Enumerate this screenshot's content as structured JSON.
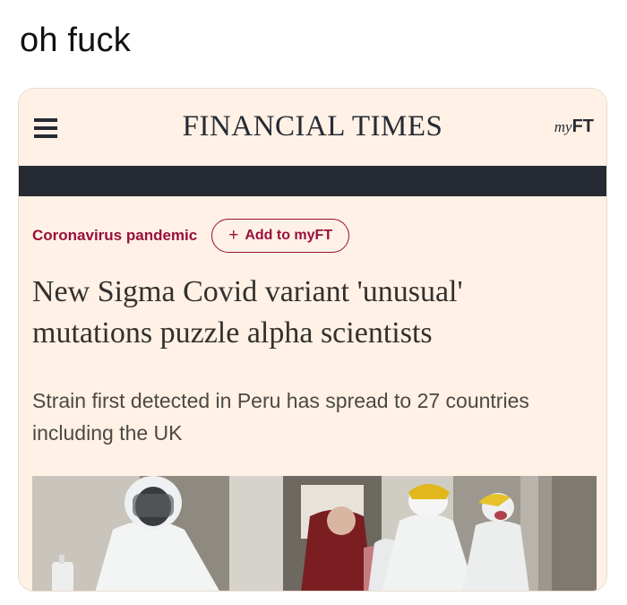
{
  "post": {
    "caption": "oh fuck"
  },
  "app": {
    "masthead": "FINANCIAL TIMES",
    "myft_prefix": "my",
    "myft_suffix": "FT"
  },
  "article": {
    "topic": "Coronavirus pandemic",
    "follow_button": "Add to myFT",
    "follow_button_icon": "+",
    "headline_line1": "New Sigma Covid variant 'unusual'",
    "headline_line2": "mutations puzzle alpha scientists",
    "standfirst_line1": "Strain first detected in Peru has spread to 27 countries",
    "standfirst_line2": "including the UK"
  },
  "icons": [
    "menu-icon"
  ],
  "colors": {
    "ft_background": "#fff1e5",
    "ft_dark": "#262a33",
    "ft_claret": "#990f3d"
  }
}
